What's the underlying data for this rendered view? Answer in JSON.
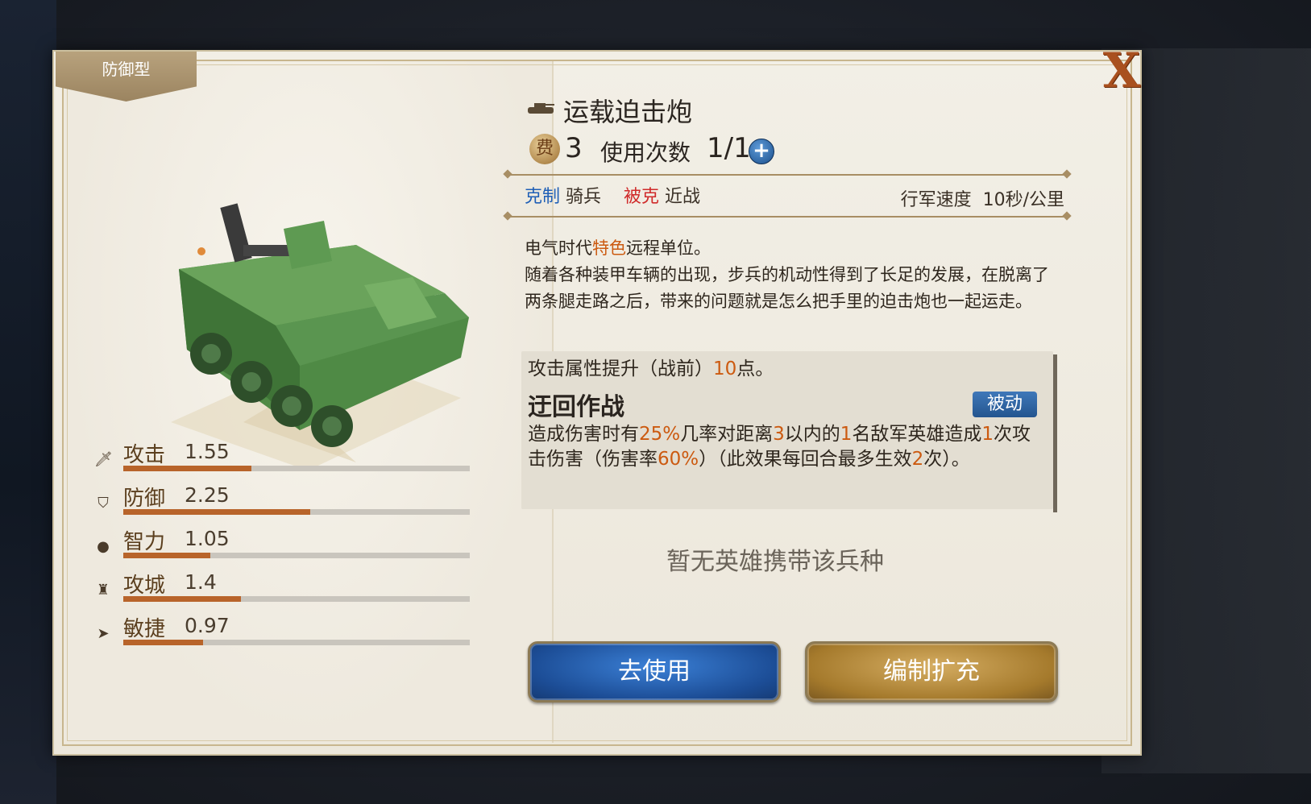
{
  "panel": {
    "type_tab": "防御型",
    "close_label": "X"
  },
  "stats": [
    {
      "icon": "sword-icon",
      "label": "攻击",
      "value": "1.55",
      "level": 0.37
    },
    {
      "icon": "shield-icon",
      "label": "防御",
      "value": "2.25",
      "level": 0.54
    },
    {
      "icon": "brain-icon",
      "label": "智力",
      "value": "1.05",
      "level": 0.25
    },
    {
      "icon": "castle-icon",
      "label": "攻城",
      "value": "1.4",
      "level": 0.34
    },
    {
      "icon": "boot-icon",
      "label": "敏捷",
      "value": "0.97",
      "level": 0.23
    }
  ],
  "unit": {
    "name": "运载迫击炮",
    "cost_icon": "费",
    "cost": "3",
    "uses_label": "使用次数",
    "uses_value": "1/1",
    "counter_label": "克制",
    "counter_value": "骑兵",
    "countered_label": "被克",
    "countered_value": "近战",
    "speed_label": "行军速度",
    "speed_value": "10秒/公里"
  },
  "description": {
    "line1_pre": "电气时代",
    "line1_hl": "特色",
    "line1_post": "远程单位。",
    "body": "随着各种装甲车辆的出现，步兵的机动性得到了长足的发展，在脱离了两条腿走路之后，带来的问题就是怎么把手里的迫击炮也一起运走。"
  },
  "skill": {
    "line1_pre": "攻击属性提升（战前）",
    "line1_hl": "10",
    "line1_post": "点。",
    "name": "迂回作战",
    "badge": "被动",
    "d1": "造成伤害时有",
    "d2": "25%",
    "d3": "几率对距离",
    "d4": "3",
    "d5": "以内的",
    "d6": "1",
    "d7": "名敌军英雄造成",
    "d8": "1",
    "d9": "次攻击伤害（伤害率",
    "d10": "60%",
    "d11": "）（此效果每回合最多生效",
    "d12": "2",
    "d13": "次）。"
  },
  "no_hero_text": "暂无英雄携带该兵种",
  "buttons": {
    "use": "去使用",
    "expand": "编制扩充"
  },
  "colors": {
    "highlight": "#cc5a10",
    "counter_blue": "#1f5fb6",
    "countered_red": "#d02a2a",
    "stat_fill": "#b8642a"
  }
}
